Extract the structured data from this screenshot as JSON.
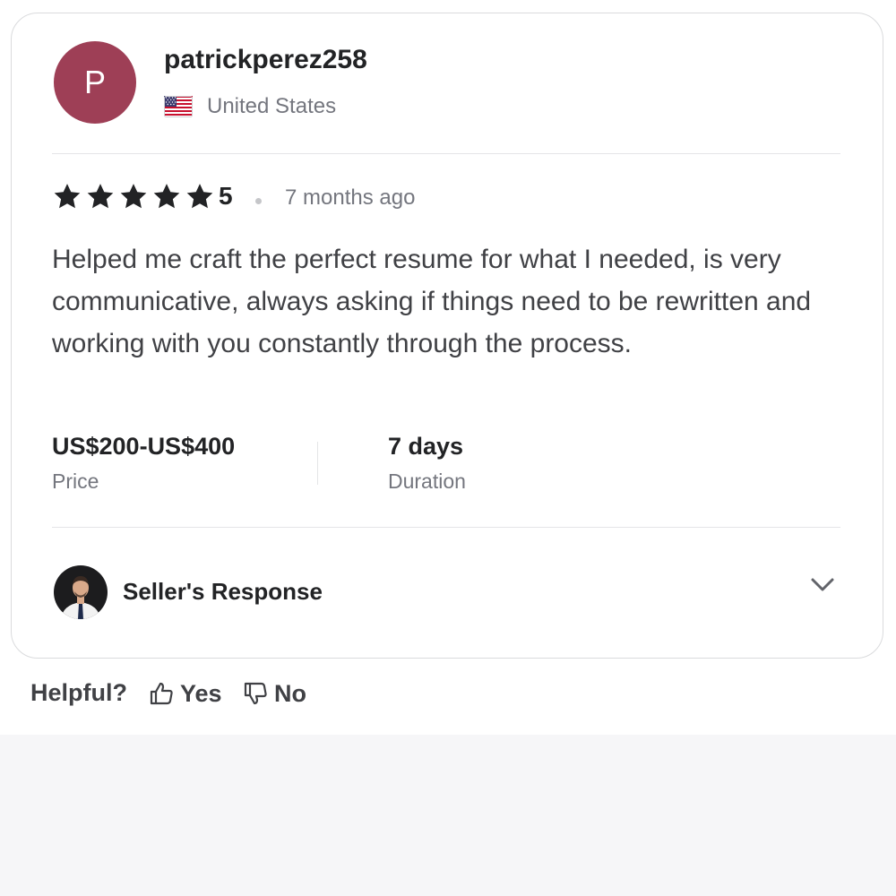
{
  "reviewer": {
    "avatar_initial": "P",
    "avatar_color": "#9e3f56",
    "username": "patrickperez258",
    "country": "United States",
    "flag_icon": "us-flag-icon"
  },
  "rating": {
    "stars": 5,
    "value": "5",
    "time_ago": "7 months ago",
    "star_color": "#222325"
  },
  "review": {
    "text": "Helped me craft the perfect resume for what I needed, is very communicative, always asking if things need to be rewritten and working with you constantly through the process."
  },
  "stats": {
    "price": {
      "value": "US$200-US$400",
      "label": "Price"
    },
    "duration": {
      "value": "7 days",
      "label": "Duration"
    }
  },
  "seller_response": {
    "label": "Seller's Response",
    "expand_icon": "chevron-down-icon"
  },
  "helpful": {
    "label": "Helpful?",
    "yes_label": "Yes",
    "no_label": "No"
  }
}
